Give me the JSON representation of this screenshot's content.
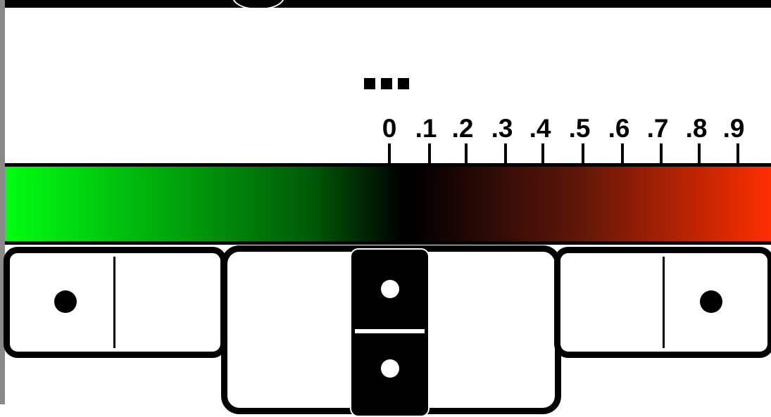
{
  "menu": {
    "icon": "ellipsis-squares-icon"
  },
  "scale": {
    "labels": [
      "0",
      ".1",
      ".2",
      ".3",
      ".4",
      ".5",
      ".6",
      ".7",
      ".8",
      ".9"
    ],
    "gradient_colors": {
      "start": "#00ff11",
      "middle": "#000000",
      "end": "#ff2f00"
    }
  },
  "dominoes": {
    "left_tile": {
      "left_pips": 1,
      "right_pips": 0
    },
    "center_tile": {
      "top_pips": 1,
      "bottom_pips": 1
    },
    "right_tile": {
      "left_pips": 0,
      "right_pips": 1
    }
  }
}
